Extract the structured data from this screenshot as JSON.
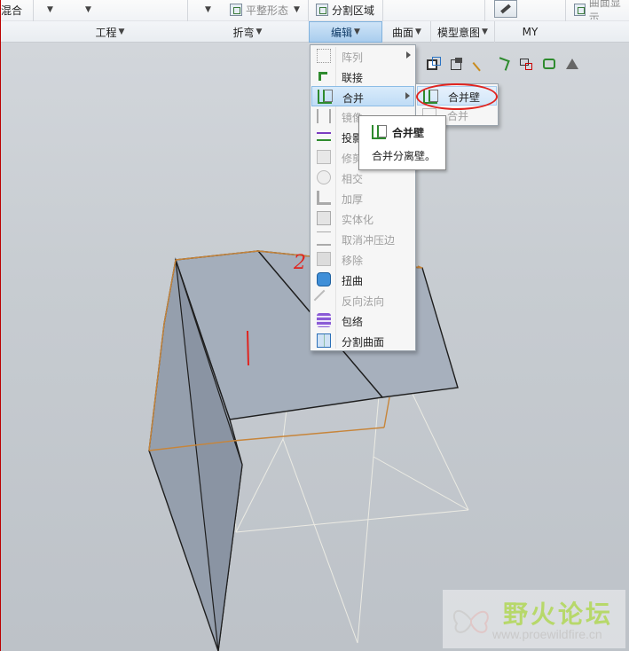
{
  "ribbon": {
    "top_row": {
      "blend_label": "混合",
      "flatten_label": "平整形态",
      "split_region_label": "分割区域",
      "surface_display_label": "曲面显示"
    },
    "groups": {
      "engineering": "工程",
      "bend": "折弯",
      "edit": "编辑",
      "surface": "曲面",
      "model_intent": "模型意图",
      "my": "MY"
    }
  },
  "edit_menu": {
    "items": [
      {
        "label": "阵列",
        "enabled": false,
        "submenu": true,
        "icon": "pattern-icon"
      },
      {
        "label": "联接",
        "enabled": true,
        "submenu": false,
        "icon": "join-icon"
      },
      {
        "label": "合并",
        "enabled": true,
        "submenu": true,
        "icon": "merge-icon",
        "active": true
      },
      {
        "label": "镜像",
        "enabled": false,
        "submenu": false,
        "icon": "mirror-icon"
      },
      {
        "label": "投影",
        "enabled": true,
        "submenu": false,
        "icon": "project-icon"
      },
      {
        "label": "修剪",
        "enabled": false,
        "submenu": false,
        "icon": "trim-icon"
      },
      {
        "label": "相交",
        "enabled": false,
        "submenu": false,
        "icon": "intersect-icon"
      },
      {
        "label": "加厚",
        "enabled": false,
        "submenu": false,
        "icon": "thicken-icon"
      },
      {
        "label": "实体化",
        "enabled": false,
        "submenu": false,
        "icon": "solidify-icon"
      },
      {
        "label": "取消冲压边",
        "enabled": false,
        "submenu": false,
        "icon": "unstamp-edges-icon"
      },
      {
        "label": "移除",
        "enabled": false,
        "submenu": false,
        "icon": "remove-icon"
      },
      {
        "label": "扭曲",
        "enabled": true,
        "submenu": false,
        "icon": "warp-icon"
      },
      {
        "label": "反向法向",
        "enabled": false,
        "submenu": false,
        "icon": "flip-normal-icon"
      },
      {
        "label": "包络",
        "enabled": true,
        "submenu": false,
        "icon": "wrap-icon"
      },
      {
        "label": "分割曲面",
        "enabled": true,
        "submenu": false,
        "icon": "split-surface-icon"
      }
    ]
  },
  "merge_submenu": {
    "items": [
      {
        "label": "合并壁",
        "enabled": true,
        "highlighted": true
      },
      {
        "label": "合并",
        "enabled": false,
        "highlighted": false
      }
    ]
  },
  "tooltip": {
    "title": "合并壁",
    "description": "合并分离壁。"
  },
  "annotations": {
    "mark_1": "|",
    "mark_2": "2"
  },
  "watermark": {
    "brand": "野火论坛",
    "url": "www.proewildfire.cn"
  },
  "colors": {
    "menu_highlight": "#bfdcf6",
    "annotation_red": "#e0241f",
    "surface_fill": "#a4aebb",
    "merge_green": "#2e8b2e"
  }
}
